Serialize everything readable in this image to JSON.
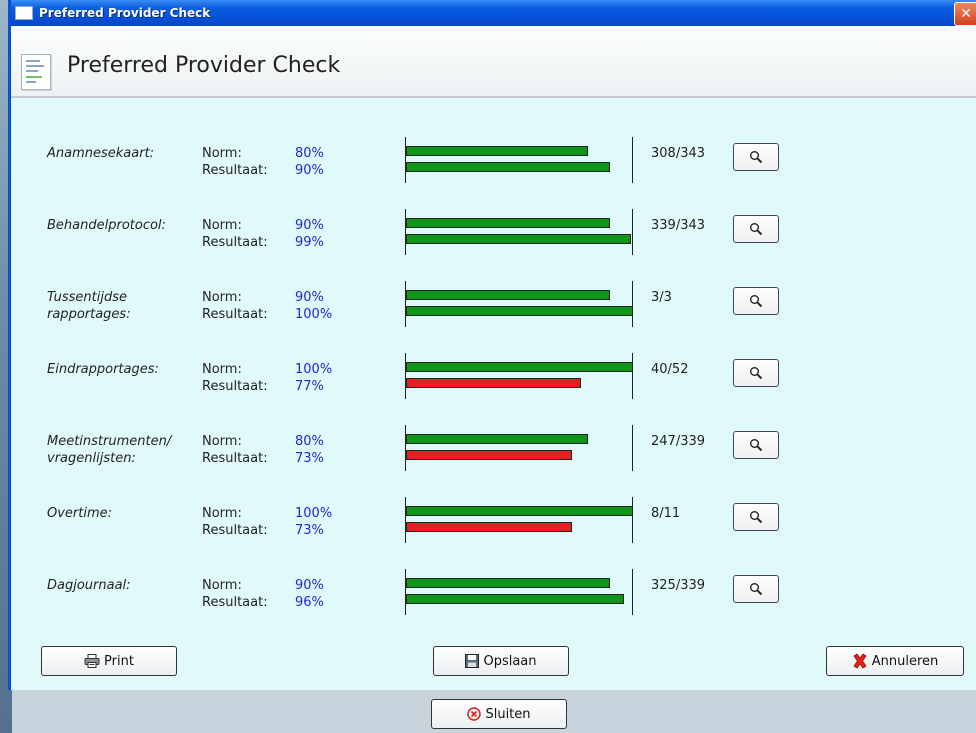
{
  "window": {
    "title": "Preferred Provider Check",
    "close_glyph": "✕"
  },
  "header": {
    "title": "Preferred Provider Check",
    "icon": "document-icon"
  },
  "labels": {
    "norm": "Norm:",
    "result": "Resultaat:"
  },
  "rows": [
    {
      "category_lines": [
        "Anamnesekaart:"
      ],
      "norm": "80%",
      "result": "90%",
      "norm_fraction": 0.8,
      "result_fraction": 0.9,
      "result_status": "green",
      "count": "308/343"
    },
    {
      "category_lines": [
        "Behandelprotocol:"
      ],
      "norm": "90%",
      "result": "99%",
      "norm_fraction": 0.9,
      "result_fraction": 0.99,
      "result_status": "green",
      "count": "339/343"
    },
    {
      "category_lines": [
        "Tussentijdse",
        "rapportages:"
      ],
      "norm": "90%",
      "result": "100%",
      "norm_fraction": 0.9,
      "result_fraction": 1.0,
      "result_status": "green",
      "count": "3/3"
    },
    {
      "category_lines": [
        "Eindrapportages:"
      ],
      "norm": "100%",
      "result": "77%",
      "norm_fraction": 1.0,
      "result_fraction": 0.77,
      "result_status": "red",
      "count": "40/52"
    },
    {
      "category_lines": [
        "Meetinstrumenten/",
        "vragenlijsten:"
      ],
      "norm": "80%",
      "result": "73%",
      "norm_fraction": 0.8,
      "result_fraction": 0.73,
      "result_status": "red",
      "count": "247/339"
    },
    {
      "category_lines": [
        "Overtime:"
      ],
      "norm": "100%",
      "result": "73%",
      "norm_fraction": 1.0,
      "result_fraction": 0.73,
      "result_status": "red",
      "count": "8/11"
    },
    {
      "category_lines": [
        "Dagjournaal:"
      ],
      "norm": "90%",
      "result": "96%",
      "norm_fraction": 0.9,
      "result_fraction": 0.96,
      "result_status": "green",
      "count": "325/339"
    }
  ],
  "colors": {
    "norm_bar": "#14931c",
    "ok": "#14931c",
    "fail": "#ec1c24",
    "value_text": "#2323e0"
  },
  "buttons": {
    "print": "Print",
    "save": "Opslaan",
    "cancel": "Annuleren",
    "close": "Sluiten"
  }
}
